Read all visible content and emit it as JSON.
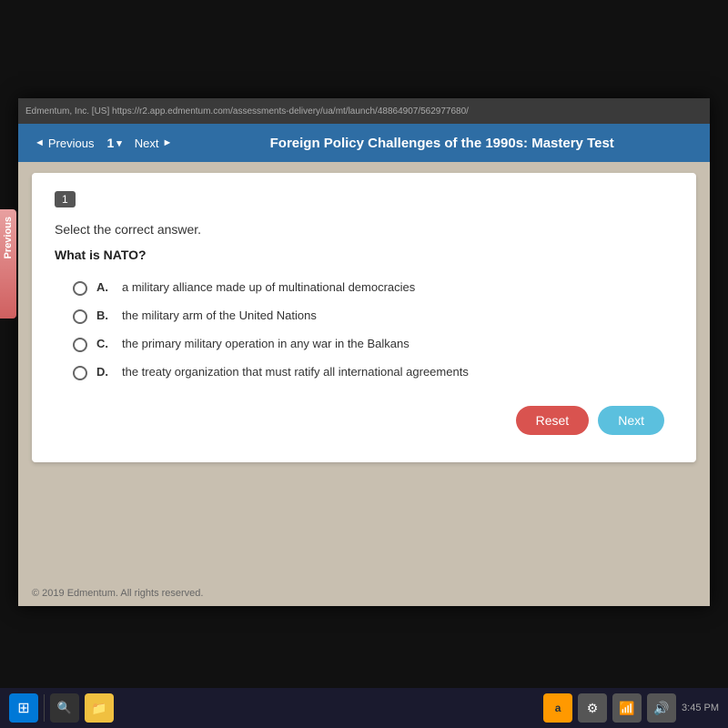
{
  "browser": {
    "url": "Edmentum, Inc. [US]  https://r2.app.edmentum.com/assessments-delivery/ua/mt/launch/48864907/562977680/"
  },
  "navbar": {
    "previous_label": "Previous",
    "question_number": "1",
    "next_label": "Next",
    "title": "Foreign Policy Challenges of the 1990s: Mastery Test"
  },
  "question": {
    "number": "1",
    "instruction": "Select the correct answer.",
    "text": "What is NATO?",
    "options": [
      {
        "letter": "A.",
        "text": "a military alliance made up of multinational democracies"
      },
      {
        "letter": "B.",
        "text": "the military arm of the United Nations"
      },
      {
        "letter": "C.",
        "text": "the primary military operation in any war in the Balkans"
      },
      {
        "letter": "D.",
        "text": "the treaty organization that must ratify all international agreements"
      }
    ]
  },
  "buttons": {
    "reset_label": "Reset",
    "next_label": "Next"
  },
  "footer": {
    "copyright": "© 2019 Edmentum. All rights reserved."
  }
}
